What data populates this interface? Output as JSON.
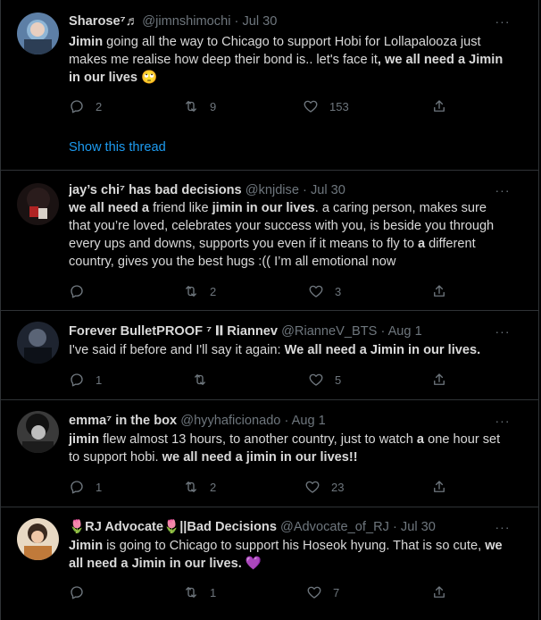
{
  "colors": {
    "background": "#000000",
    "text": "#d9d9d9",
    "muted": "#6e767d",
    "link": "#1d9bf0",
    "divider": "#2f3336"
  },
  "tweets": [
    {
      "name": "Sharose⁷♬",
      "handle": "@jimnshimochi",
      "dot": "·",
      "date": "Jul 30",
      "more": "···",
      "text_parts": [
        "Jimin",
        " going all the way to Chicago to support Hobi for Lollapalooza just makes me realise how deep their bond is.. let's face it",
        ", we all need a Jimin in our lives",
        " 🙄"
      ],
      "reply_count": "2",
      "retweet_count": "9",
      "like_count": "153",
      "show_thread": "Show this thread"
    },
    {
      "name": "jay’s chi⁷ has bad decisions",
      "handle": "@knjdise",
      "dot": "·",
      "date": "Jul 30",
      "more": "···",
      "text_parts": [
        "we all need a",
        " friend like ",
        "jimin in our lives",
        ". a caring person, makes sure that you’re loved, celebrates your success with you, is beside you through every ups and downs, supports you even if it means to fly to ",
        "a",
        " different country, gives you the best hugs :(( I’m all emotional now"
      ],
      "reply_count": "",
      "retweet_count": "2",
      "like_count": "3"
    },
    {
      "name": "Forever BulletPROOF ⁷ 𝐈𝐈 Riannev",
      "handle": "@RianneV_BTS",
      "dot": "·",
      "date": "Aug 1",
      "more": "···",
      "text_parts": [
        "I've said if before and I'll say it again: ",
        "We all need a Jimin in our lives."
      ],
      "reply_count": "1",
      "retweet_count": "",
      "like_count": "5"
    },
    {
      "name": "emma⁷ in the box",
      "handle": "@hyyhaficionado",
      "dot": "·",
      "date": "Aug 1",
      "more": "···",
      "text_parts": [
        "jimin",
        " flew almost 13 hours, to another country, just to watch ",
        "a",
        " one hour set to support hobi. ",
        "we all need a jimin in our lives!!"
      ],
      "reply_count": "1",
      "retweet_count": "2",
      "like_count": "23"
    },
    {
      "name": "🌷RJ Advocate🌷||Bad Decisions",
      "handle": "@Advocate_of_RJ",
      "dot": "·",
      "date": "Jul 30",
      "more": "···",
      "text_parts": [
        "Jimin",
        " is going to Chicago to support his Hoseok hyung. That is so cute, ",
        "we all need a Jimin in our lives.",
        " 💜"
      ],
      "reply_count": "",
      "retweet_count": "1",
      "like_count": "7"
    }
  ]
}
